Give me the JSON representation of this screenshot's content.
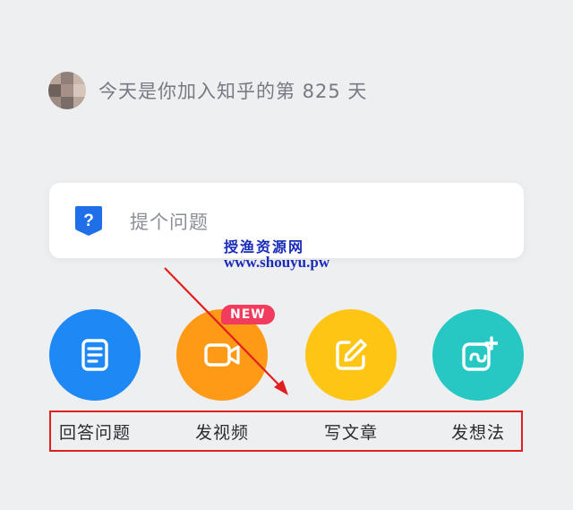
{
  "header": {
    "avatar_icon": "user-avatar-blurred",
    "join_text": "今天是你加入知乎的第 825 天"
  },
  "ask": {
    "icon": "question-mark-icon",
    "placeholder": "提个问题"
  },
  "actions": [
    {
      "label": "回答问题",
      "icon": "document-icon",
      "color": "#1e88f5"
    },
    {
      "label": "发视频",
      "icon": "video-camera-icon",
      "color": "#ff9a17",
      "badge": "NEW"
    },
    {
      "label": "写文章",
      "icon": "edit-pencil-icon",
      "color": "#ffc515"
    },
    {
      "label": "发想法",
      "icon": "idea-plus-icon",
      "color": "#27c8c3"
    }
  ],
  "annotation": {
    "highlight_color": "#e21f1f",
    "arrow_color": "#e21f1f"
  },
  "watermark": {
    "title": "授渔资源网",
    "url": "www.shouyu.pw",
    "color": "#1a2cb8"
  }
}
